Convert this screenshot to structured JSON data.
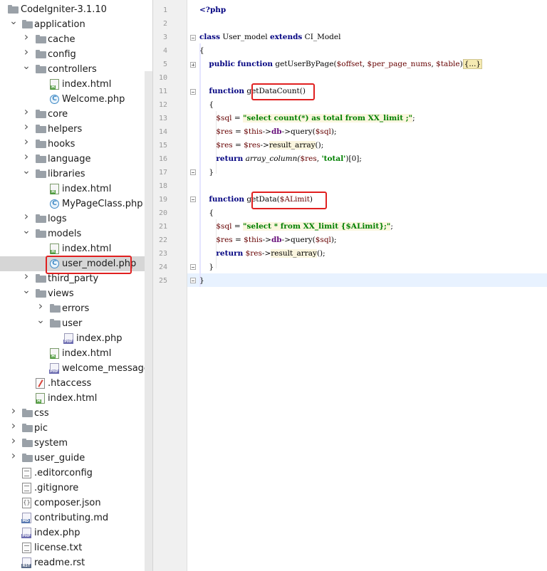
{
  "project_tree": {
    "root": "CodeIgniter-3.1.10",
    "items": [
      {
        "label": "CodeIgniter-3.1.10",
        "type": "folder",
        "depth": 0,
        "state": "none"
      },
      {
        "label": "application",
        "type": "folder",
        "depth": 1,
        "state": "open"
      },
      {
        "label": "cache",
        "type": "folder",
        "depth": 2,
        "state": "closed"
      },
      {
        "label": "config",
        "type": "folder",
        "depth": 2,
        "state": "closed"
      },
      {
        "label": "controllers",
        "type": "folder",
        "depth": 2,
        "state": "open"
      },
      {
        "label": "index.html",
        "type": "html",
        "depth": 3,
        "state": "none"
      },
      {
        "label": "Welcome.php",
        "type": "class",
        "depth": 3,
        "state": "none"
      },
      {
        "label": "core",
        "type": "folder",
        "depth": 2,
        "state": "closed"
      },
      {
        "label": "helpers",
        "type": "folder",
        "depth": 2,
        "state": "closed"
      },
      {
        "label": "hooks",
        "type": "folder",
        "depth": 2,
        "state": "closed"
      },
      {
        "label": "language",
        "type": "folder",
        "depth": 2,
        "state": "closed"
      },
      {
        "label": "libraries",
        "type": "folder",
        "depth": 2,
        "state": "open"
      },
      {
        "label": "index.html",
        "type": "html",
        "depth": 3,
        "state": "none"
      },
      {
        "label": "MyPageClass.php",
        "type": "class",
        "depth": 3,
        "state": "none"
      },
      {
        "label": "logs",
        "type": "folder",
        "depth": 2,
        "state": "closed"
      },
      {
        "label": "models",
        "type": "folder",
        "depth": 2,
        "state": "open"
      },
      {
        "label": "index.html",
        "type": "html",
        "depth": 3,
        "state": "none"
      },
      {
        "label": "user_model.php",
        "type": "class",
        "depth": 3,
        "state": "none",
        "selected": true,
        "highlight": true
      },
      {
        "label": "third_party",
        "type": "folder",
        "depth": 2,
        "state": "closed"
      },
      {
        "label": "views",
        "type": "folder",
        "depth": 2,
        "state": "open"
      },
      {
        "label": "errors",
        "type": "folder",
        "depth": 3,
        "state": "closed"
      },
      {
        "label": "user",
        "type": "folder",
        "depth": 3,
        "state": "open"
      },
      {
        "label": "index.php",
        "type": "php",
        "depth": 4,
        "state": "none"
      },
      {
        "label": "index.html",
        "type": "html",
        "depth": 3,
        "state": "none"
      },
      {
        "label": "welcome_message.ph",
        "type": "php",
        "depth": 3,
        "state": "none"
      },
      {
        "label": ".htaccess",
        "type": "htaccess",
        "depth": 2,
        "state": "none"
      },
      {
        "label": "index.html",
        "type": "html",
        "depth": 2,
        "state": "none"
      },
      {
        "label": "css",
        "type": "folder",
        "depth": 1,
        "state": "closed"
      },
      {
        "label": "pic",
        "type": "folder",
        "depth": 1,
        "state": "closed"
      },
      {
        "label": "system",
        "type": "folder",
        "depth": 1,
        "state": "closed"
      },
      {
        "label": "user_guide",
        "type": "folder",
        "depth": 1,
        "state": "closed"
      },
      {
        "label": ".editorconfig",
        "type": "text",
        "depth": 1,
        "state": "none"
      },
      {
        "label": ".gitignore",
        "type": "text",
        "depth": 1,
        "state": "none"
      },
      {
        "label": "composer.json",
        "type": "json",
        "depth": 1,
        "state": "none"
      },
      {
        "label": "contributing.md",
        "type": "md",
        "depth": 1,
        "state": "none"
      },
      {
        "label": "index.php",
        "type": "php",
        "depth": 1,
        "state": "none"
      },
      {
        "label": "license.txt",
        "type": "text",
        "depth": 1,
        "state": "none"
      },
      {
        "label": "readme.rst",
        "type": "rst",
        "depth": 1,
        "state": "none"
      }
    ]
  },
  "editor": {
    "line_numbers": [
      "1",
      "2",
      "3",
      "4",
      "5",
      "10",
      "11",
      "12",
      "13",
      "14",
      "15",
      "16",
      "17",
      "18",
      "19",
      "20",
      "21",
      "22",
      "23",
      "24",
      "25"
    ],
    "code": {
      "l1": "<?php",
      "l3_class": "class",
      "l3_name": " User_model ",
      "l3_extends": "extends",
      "l3_parent": " CI_Model",
      "l4": "{",
      "l5_public": "public",
      "l5_function": "function",
      "l5_name": " getUserByPage(",
      "l5_v1": "$offset",
      "l5_c1": ", ",
      "l5_v2": "$per_page_nums",
      "l5_c2": ", ",
      "l5_v3": "$table",
      "l5_close": ")",
      "l5_collapsed": "{...}",
      "l11_function": "function",
      "l11_name": "getDataCount",
      "l11_parens": "()",
      "l12": "{",
      "l13_var": "$sql",
      "l13_eq": " = ",
      "l13_str": "\"select count(*) as total from XX_limit ;\"",
      "l13_end": ";",
      "l14_var": "$res",
      "l14_eq": " = ",
      "l14_this": "$this",
      "l14_arrow": "->",
      "l14_db": "db",
      "l14_arrow2": "->",
      "l14_call": "query(",
      "l14_arg": "$sql",
      "l14_end": ");",
      "l15_var": "$res",
      "l15_eq": " = ",
      "l15_obj": "$res",
      "l15_arrow": "->",
      "l15_call": "result_array",
      "l15_end": "();",
      "l16_return": "return",
      "l16_fn": " array_column(",
      "l16_arg": "$res",
      "l16_c": ", ",
      "l16_str": "'total'",
      "l16_end": ")[0];",
      "l17": "}",
      "l19_function": "function",
      "l19_name": "getData(",
      "l19_arg": "$ALimit",
      "l19_close": ")",
      "l20": "{",
      "l21_var": "$sql",
      "l21_eq": " = ",
      "l21_str": "\"select * from XX_limit {$ALimit};\"",
      "l21_end": ";",
      "l22_var": "$res",
      "l22_eq": " = ",
      "l22_this": "$this",
      "l22_arrow": "->",
      "l22_db": "db",
      "l22_arrow2": "->",
      "l22_call": "query(",
      "l22_arg": "$sql",
      "l22_end": ");",
      "l23_return": "return",
      "l23_obj": " $res",
      "l23_arrow": "->",
      "l23_call": "result_array",
      "l23_end": "();",
      "l24": "}",
      "l25": "}"
    }
  },
  "colors": {
    "highlight_box": "#e02020",
    "keyword": "#000080",
    "variable": "#660000",
    "string": "#008000",
    "selection_row": "#d6d6d6"
  }
}
